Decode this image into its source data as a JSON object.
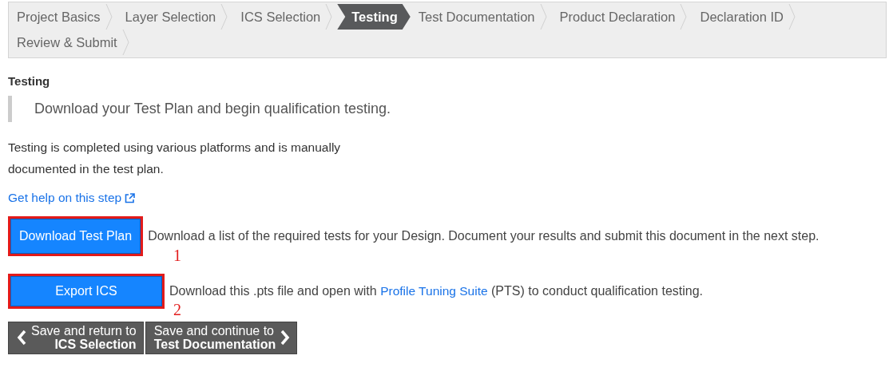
{
  "steps": [
    {
      "label": "Project Basics",
      "selected": false
    },
    {
      "label": "Layer Selection",
      "selected": false
    },
    {
      "label": "ICS Selection",
      "selected": false
    },
    {
      "label": "Testing",
      "selected": true
    },
    {
      "label": "Test Documentation",
      "selected": false
    },
    {
      "label": "Product Declaration",
      "selected": false
    },
    {
      "label": "Declaration ID",
      "selected": false
    },
    {
      "label": "Review & Submit",
      "selected": false
    }
  ],
  "heading": "Testing",
  "callout": "Download your Test Plan and begin qualification testing.",
  "intro": "Testing is completed using various platforms and is manually documented in the test plan.",
  "help_link": "Get help on this step",
  "actions": [
    {
      "button": "Download Test Plan",
      "marker": "1",
      "text_before": "Download a list of the required tests for your Design. Document your results and submit this document in the next step."
    },
    {
      "button": "Export ICS",
      "marker": "2",
      "text_before": "Download this .pts file and open with ",
      "link": "Profile Tuning Suite",
      "text_after": " (PTS) to conduct qualification testing."
    }
  ],
  "nav": [
    {
      "kind": "back",
      "line1": "Save and return to",
      "line2": "ICS Selection"
    },
    {
      "kind": "next",
      "line1": "Save and continue to",
      "line2": "Test Documentation"
    }
  ]
}
